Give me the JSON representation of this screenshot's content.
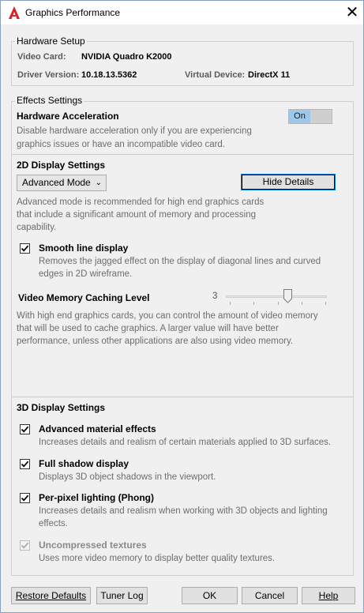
{
  "window": {
    "title": "Graphics Performance"
  },
  "hardware": {
    "legend": "Hardware Setup",
    "video_card_label": "Video Card:",
    "video_card_value": "NVIDIA Quadro K2000",
    "driver_label": "Driver Version:",
    "driver_value": "10.18.13.5362",
    "virtual_label": "Virtual Device:",
    "virtual_value": "DirectX 11"
  },
  "effects": {
    "legend": "Effects Settings",
    "hw_accel_title": "Hardware Acceleration",
    "hw_accel_desc1": "Disable hardware acceleration only if you are experiencing",
    "hw_accel_desc2": "graphics issues or have an incompatible video card.",
    "toggle_label": "On",
    "toggle_state": true,
    "display2d_title": "2D Display Settings",
    "mode_selected": "Advanced Mode",
    "hide_details_label": "Hide Details",
    "mode_desc1": "Advanced mode is recommended for high end graphics cards",
    "mode_desc2": "that include a significant amount of memory and processing",
    "mode_desc3": "capability.",
    "smooth_label": "Smooth line display",
    "smooth_checked": true,
    "smooth_desc1": "Removes the jagged effect on the display of diagonal lines and curved",
    "smooth_desc2": "edges in 2D wireframe.",
    "vmc_title": "Video Memory Caching Level",
    "vmc_value": "3",
    "vmc_fraction": 0.6,
    "vmc_desc1": "With high end graphics cards, you can control the amount of video memory",
    "vmc_desc2": "that will be used to cache graphics.  A larger value will have better",
    "vmc_desc3": "performance, unless other applications are also using video memory.",
    "display3d_title": "3D Display Settings",
    "material_label": "Advanced material effects",
    "material_desc": "Increases details and realism of certain materials applied to 3D surfaces.",
    "shadow_label": "Full shadow display",
    "shadow_desc": "Displays 3D object shadows in the viewport.",
    "phong_label": "Per-pixel lighting (Phong)",
    "phong_desc1": "Increases details and realism when working with 3D objects and lighting",
    "phong_desc2": "effects.",
    "textures_label": "Uncompressed textures",
    "textures_desc": "Uses more video memory to display better quality textures."
  },
  "footer": {
    "restore_label": "Restore Defaults",
    "tuner_label": "Tuner Log",
    "ok_label": "OK",
    "cancel_label": "Cancel",
    "help_label": "Help"
  },
  "colors": {
    "toggle_on": "#9ec7ea",
    "focus": "#0078d7"
  }
}
